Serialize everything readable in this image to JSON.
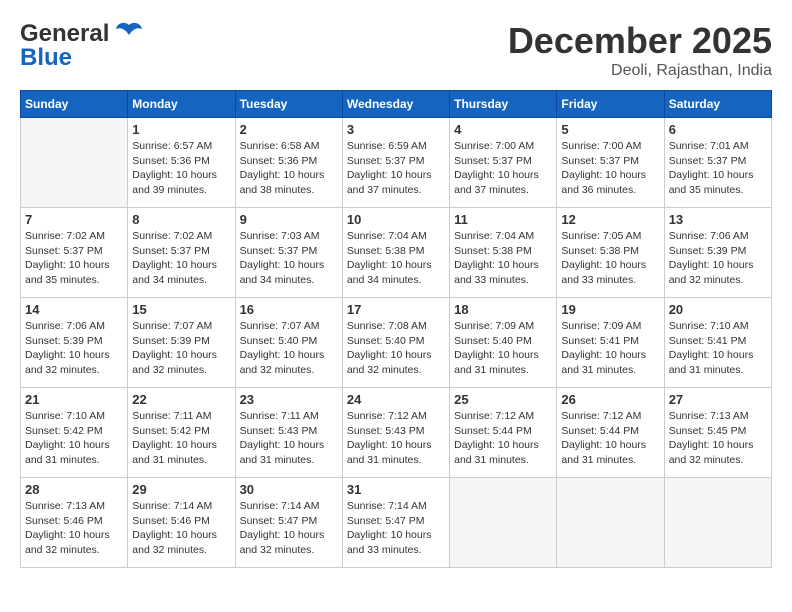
{
  "header": {
    "logo_general": "General",
    "logo_blue": "Blue",
    "month": "December 2025",
    "location": "Deoli, Rajasthan, India"
  },
  "days_of_week": [
    "Sunday",
    "Monday",
    "Tuesday",
    "Wednesday",
    "Thursday",
    "Friday",
    "Saturday"
  ],
  "weeks": [
    [
      {
        "day": "",
        "sunrise": "",
        "sunset": "",
        "daylight": ""
      },
      {
        "day": "1",
        "sunrise": "Sunrise: 6:57 AM",
        "sunset": "Sunset: 5:36 PM",
        "daylight": "Daylight: 10 hours and 39 minutes."
      },
      {
        "day": "2",
        "sunrise": "Sunrise: 6:58 AM",
        "sunset": "Sunset: 5:36 PM",
        "daylight": "Daylight: 10 hours and 38 minutes."
      },
      {
        "day": "3",
        "sunrise": "Sunrise: 6:59 AM",
        "sunset": "Sunset: 5:37 PM",
        "daylight": "Daylight: 10 hours and 37 minutes."
      },
      {
        "day": "4",
        "sunrise": "Sunrise: 7:00 AM",
        "sunset": "Sunset: 5:37 PM",
        "daylight": "Daylight: 10 hours and 37 minutes."
      },
      {
        "day": "5",
        "sunrise": "Sunrise: 7:00 AM",
        "sunset": "Sunset: 5:37 PM",
        "daylight": "Daylight: 10 hours and 36 minutes."
      },
      {
        "day": "6",
        "sunrise": "Sunrise: 7:01 AM",
        "sunset": "Sunset: 5:37 PM",
        "daylight": "Daylight: 10 hours and 35 minutes."
      }
    ],
    [
      {
        "day": "7",
        "sunrise": "Sunrise: 7:02 AM",
        "sunset": "Sunset: 5:37 PM",
        "daylight": "Daylight: 10 hours and 35 minutes."
      },
      {
        "day": "8",
        "sunrise": "Sunrise: 7:02 AM",
        "sunset": "Sunset: 5:37 PM",
        "daylight": "Daylight: 10 hours and 34 minutes."
      },
      {
        "day": "9",
        "sunrise": "Sunrise: 7:03 AM",
        "sunset": "Sunset: 5:37 PM",
        "daylight": "Daylight: 10 hours and 34 minutes."
      },
      {
        "day": "10",
        "sunrise": "Sunrise: 7:04 AM",
        "sunset": "Sunset: 5:38 PM",
        "daylight": "Daylight: 10 hours and 34 minutes."
      },
      {
        "day": "11",
        "sunrise": "Sunrise: 7:04 AM",
        "sunset": "Sunset: 5:38 PM",
        "daylight": "Daylight: 10 hours and 33 minutes."
      },
      {
        "day": "12",
        "sunrise": "Sunrise: 7:05 AM",
        "sunset": "Sunset: 5:38 PM",
        "daylight": "Daylight: 10 hours and 33 minutes."
      },
      {
        "day": "13",
        "sunrise": "Sunrise: 7:06 AM",
        "sunset": "Sunset: 5:39 PM",
        "daylight": "Daylight: 10 hours and 32 minutes."
      }
    ],
    [
      {
        "day": "14",
        "sunrise": "Sunrise: 7:06 AM",
        "sunset": "Sunset: 5:39 PM",
        "daylight": "Daylight: 10 hours and 32 minutes."
      },
      {
        "day": "15",
        "sunrise": "Sunrise: 7:07 AM",
        "sunset": "Sunset: 5:39 PM",
        "daylight": "Daylight: 10 hours and 32 minutes."
      },
      {
        "day": "16",
        "sunrise": "Sunrise: 7:07 AM",
        "sunset": "Sunset: 5:40 PM",
        "daylight": "Daylight: 10 hours and 32 minutes."
      },
      {
        "day": "17",
        "sunrise": "Sunrise: 7:08 AM",
        "sunset": "Sunset: 5:40 PM",
        "daylight": "Daylight: 10 hours and 32 minutes."
      },
      {
        "day": "18",
        "sunrise": "Sunrise: 7:09 AM",
        "sunset": "Sunset: 5:40 PM",
        "daylight": "Daylight: 10 hours and 31 minutes."
      },
      {
        "day": "19",
        "sunrise": "Sunrise: 7:09 AM",
        "sunset": "Sunset: 5:41 PM",
        "daylight": "Daylight: 10 hours and 31 minutes."
      },
      {
        "day": "20",
        "sunrise": "Sunrise: 7:10 AM",
        "sunset": "Sunset: 5:41 PM",
        "daylight": "Daylight: 10 hours and 31 minutes."
      }
    ],
    [
      {
        "day": "21",
        "sunrise": "Sunrise: 7:10 AM",
        "sunset": "Sunset: 5:42 PM",
        "daylight": "Daylight: 10 hours and 31 minutes."
      },
      {
        "day": "22",
        "sunrise": "Sunrise: 7:11 AM",
        "sunset": "Sunset: 5:42 PM",
        "daylight": "Daylight: 10 hours and 31 minutes."
      },
      {
        "day": "23",
        "sunrise": "Sunrise: 7:11 AM",
        "sunset": "Sunset: 5:43 PM",
        "daylight": "Daylight: 10 hours and 31 minutes."
      },
      {
        "day": "24",
        "sunrise": "Sunrise: 7:12 AM",
        "sunset": "Sunset: 5:43 PM",
        "daylight": "Daylight: 10 hours and 31 minutes."
      },
      {
        "day": "25",
        "sunrise": "Sunrise: 7:12 AM",
        "sunset": "Sunset: 5:44 PM",
        "daylight": "Daylight: 10 hours and 31 minutes."
      },
      {
        "day": "26",
        "sunrise": "Sunrise: 7:12 AM",
        "sunset": "Sunset: 5:44 PM",
        "daylight": "Daylight: 10 hours and 31 minutes."
      },
      {
        "day": "27",
        "sunrise": "Sunrise: 7:13 AM",
        "sunset": "Sunset: 5:45 PM",
        "daylight": "Daylight: 10 hours and 32 minutes."
      }
    ],
    [
      {
        "day": "28",
        "sunrise": "Sunrise: 7:13 AM",
        "sunset": "Sunset: 5:46 PM",
        "daylight": "Daylight: 10 hours and 32 minutes."
      },
      {
        "day": "29",
        "sunrise": "Sunrise: 7:14 AM",
        "sunset": "Sunset: 5:46 PM",
        "daylight": "Daylight: 10 hours and 32 minutes."
      },
      {
        "day": "30",
        "sunrise": "Sunrise: 7:14 AM",
        "sunset": "Sunset: 5:47 PM",
        "daylight": "Daylight: 10 hours and 32 minutes."
      },
      {
        "day": "31",
        "sunrise": "Sunrise: 7:14 AM",
        "sunset": "Sunset: 5:47 PM",
        "daylight": "Daylight: 10 hours and 33 minutes."
      },
      {
        "day": "",
        "sunrise": "",
        "sunset": "",
        "daylight": ""
      },
      {
        "day": "",
        "sunrise": "",
        "sunset": "",
        "daylight": ""
      },
      {
        "day": "",
        "sunrise": "",
        "sunset": "",
        "daylight": ""
      }
    ]
  ]
}
